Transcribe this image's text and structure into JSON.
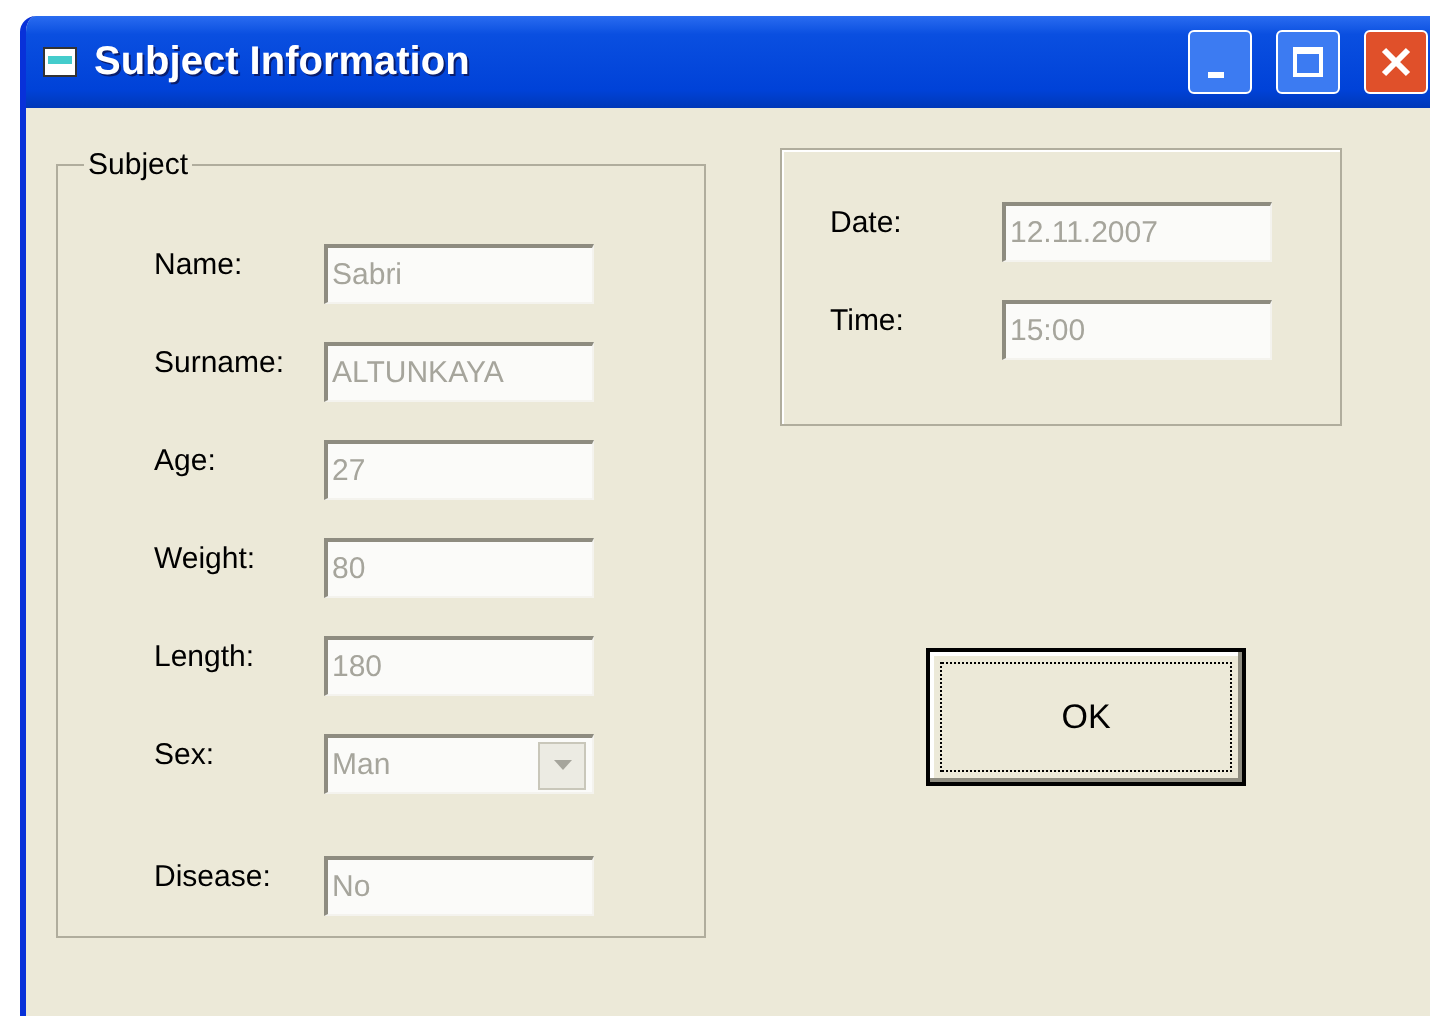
{
  "window": {
    "title": "Subject Information"
  },
  "subject_group": {
    "title": "Subject",
    "fields": [
      {
        "label": "Name:",
        "value": "Sabri",
        "kind": "text",
        "disabled": true
      },
      {
        "label": "Surname:",
        "value": "ALTUNKAYA",
        "kind": "text",
        "disabled": true
      },
      {
        "label": "Age:",
        "value": "27",
        "kind": "text",
        "disabled": true
      },
      {
        "label": "Weight:",
        "value": "80",
        "kind": "text",
        "disabled": true
      },
      {
        "label": "Length:",
        "value": "180",
        "kind": "text",
        "disabled": true
      },
      {
        "label": "Sex:",
        "value": "Man",
        "kind": "dropdown",
        "disabled": true
      },
      {
        "label": "Disease:",
        "value": "No",
        "kind": "text",
        "disabled": true
      }
    ]
  },
  "datetime_group": {
    "fields": [
      {
        "label": "Date:",
        "value": "12.11.2007",
        "kind": "text",
        "disabled": true
      },
      {
        "label": "Time:",
        "value": "15:00",
        "kind": "text",
        "disabled": true
      }
    ]
  },
  "ok_button": {
    "label": "OK",
    "focused": true
  }
}
